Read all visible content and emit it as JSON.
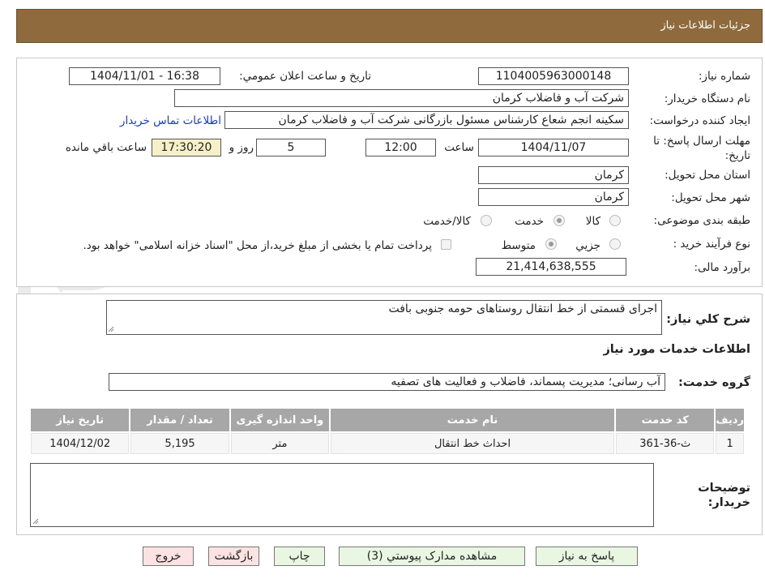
{
  "header": {
    "title": "جزئیات اطلاعات نیاز"
  },
  "watermark": {
    "text": "AriaTender.net"
  },
  "fields": {
    "need_number_label": "شماره نیاز:",
    "need_number_value": "1104005963000148",
    "announce_label": "تاریخ و ساعت اعلان عمومي:",
    "announce_value": "1404/11/01 - 16:38",
    "buyer_org_label": "نام دستگاه خريدار:",
    "buyer_org_value": "شرکت آب و فاضلاب کرمان",
    "creator_label": "ايجاد كننده درخواست:",
    "creator_value": "سکینه انجم شعاع کارشناس مسئول بازرگانی شرکت آب و فاضلاب کرمان",
    "contact_link": "اطلاعات تماس خريدار",
    "deadline_label_1": "مهلت ارسال پاسخ: تا",
    "deadline_label_2": "تاريخ:",
    "deadline_date": "1404/11/07",
    "time_label": "ساعت",
    "deadline_time": "12:00",
    "days_value": "5",
    "days_label": "روز و",
    "remaining_value": "17:30:20",
    "remaining_label": "ساعت باقي مانده",
    "province_label": "استان محل تحويل:",
    "province_value": "کرمان",
    "city_label": "شهر محل تحويل:",
    "city_value": "کرمان",
    "category_label": "طبقه بندی موضوعی:",
    "category_options": [
      {
        "label": "کالا",
        "selected": false
      },
      {
        "label": "خدمت",
        "selected": true
      },
      {
        "label": "کالا/خدمت",
        "selected": false
      }
    ],
    "process_label": "نوع فرآيند خريد :",
    "process_options": [
      {
        "label": "جزیي",
        "selected": false
      },
      {
        "label": "متوسط",
        "selected": true
      }
    ],
    "payment_note": "پرداخت تمام یا بخشی از مبلغ خرید،از محل \"اسناد خزانه اسلامی\" خواهد بود.",
    "budget_label": "برآورد مالی:",
    "budget_value": "21,414,638,555"
  },
  "summary": {
    "label": "شرح کلي نیاز:",
    "value": "اجرای قسمتی از خط انتقال روستاهای حومه جنوبی بافت"
  },
  "services": {
    "section_title": "اطلاعات خدمات مورد نیاز",
    "group_label": "گروه خدمت:",
    "group_value": "آب رسانی؛ مدیریت پسماند، فاضلاب و فعالیت های تصفیه",
    "columns": [
      "رديف",
      "کد خدمت",
      "نام خدمت",
      "واحد اندازه گیری",
      "تعداد / مقدار",
      "تاريخ نياز"
    ],
    "rows": [
      [
        "1",
        "ث-36-361",
        "احداث خط انتقال",
        "متر",
        "5,195",
        "1404/12/02"
      ]
    ]
  },
  "buyer_notes": {
    "label_1": "توضیحات",
    "label_2": "خریدار:",
    "value": ""
  },
  "buttons": {
    "reply": "پاسخ به نیاز",
    "attachments": "مشاهده مدارک پیوستي (3)",
    "print": "چاپ",
    "back": "بازگشت",
    "exit": "خروج"
  }
}
